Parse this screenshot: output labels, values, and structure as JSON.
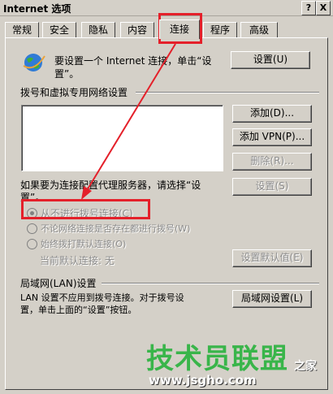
{
  "window": {
    "title": "Internet 选项",
    "help_btn": "?",
    "close_btn": "X"
  },
  "tabs": [
    {
      "label": "常规"
    },
    {
      "label": "安全"
    },
    {
      "label": "隐私"
    },
    {
      "label": "内容"
    },
    {
      "label": "连接",
      "active": true
    },
    {
      "label": "程序"
    },
    {
      "label": "高级"
    }
  ],
  "setup": {
    "text_line1": "要设置一个 Internet 连接，单击“设",
    "text_line2": "置”。",
    "button": "设置(U)"
  },
  "dialup": {
    "group_label": "拨号和虚拟专用网络设置",
    "add_button": "添加(D)...",
    "add_vpn_button": "添加 VPN(P)...",
    "delete_button": "删除(R)...",
    "proxy_text_line1": "如果要为连接配置代理服务器，请选择“设",
    "proxy_text_line2": "置”。",
    "settings_button": "设置(S)",
    "radio_never": "从不进行拨号连接(C)",
    "radio_when_absent": "不论网络连接是否存在都进行拨号(W)",
    "radio_always": "始终拨打默认连接(O)",
    "current_default": "当前默认连接: 无",
    "set_default_button": "设置默认值(E)"
  },
  "lan": {
    "group_label": "局域网(LAN)设置",
    "text_line1": "LAN 设置不应用到拨号连接。对于拨号设",
    "text_line2": "置，单击上面的“设置”按钮。",
    "button": "局域网设置(L)"
  },
  "watermark": {
    "brand": "技术员联盟",
    "brand_suffix": "之家",
    "url": "www.jsgho.com"
  },
  "colors": {
    "highlight": "#e4202a",
    "watermark_green": "#39b54a"
  }
}
